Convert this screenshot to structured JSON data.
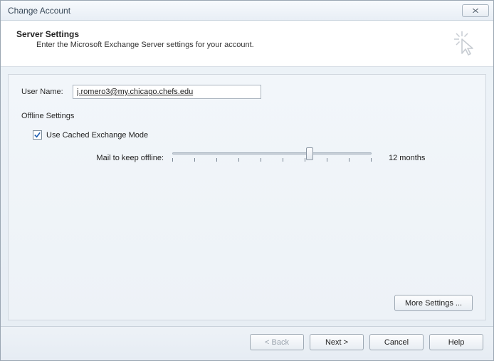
{
  "window": {
    "title": "Change Account"
  },
  "header": {
    "title": "Server Settings",
    "subtitle": "Enter the Microsoft Exchange Server settings for your account."
  },
  "form": {
    "username_label": "User Name:",
    "username_value": "j.romero3@my.chicago.chefs.edu",
    "offline_section": "Offline Settings",
    "cached_mode_label": "Use Cached Exchange Mode",
    "cached_mode_checked": true,
    "mail_offline_label": "Mail to keep offline:",
    "mail_offline_value": "12 months"
  },
  "buttons": {
    "more_settings": "More Settings ...",
    "back": "< Back",
    "next": "Next >",
    "cancel": "Cancel",
    "help": "Help"
  }
}
